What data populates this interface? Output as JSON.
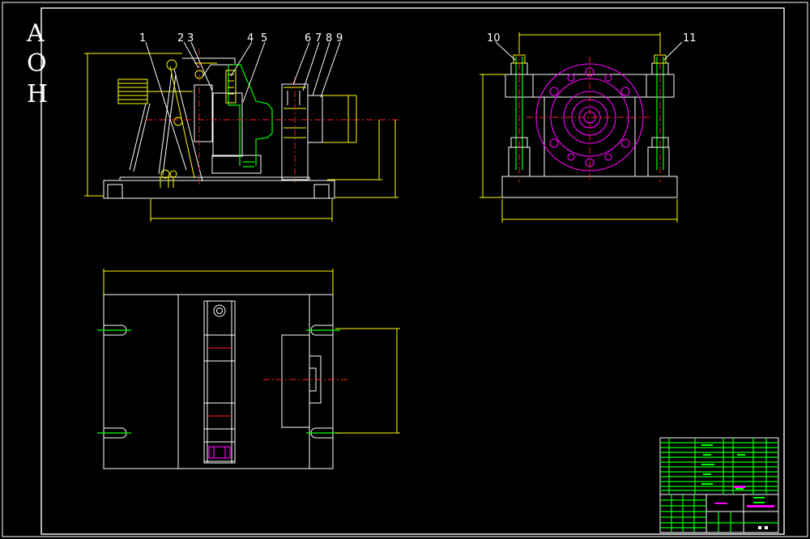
{
  "stamp": {
    "letters": [
      "A",
      "O",
      "H"
    ]
  },
  "balloons": {
    "b1": "1",
    "b2": "2",
    "b3": "3",
    "b4": "4",
    "b5": "5",
    "b6": "6",
    "b7": "7",
    "b8": "8",
    "b9": "9",
    "b10": "10",
    "b11": "11"
  },
  "colors": {
    "background": "#000000",
    "outline": "#ffffff",
    "centerline": "#ff2020",
    "dimension": "#ffff00",
    "part_green": "#00ff00",
    "part_magenta": "#ff00ff",
    "hatch_cyan": "#00ffff"
  }
}
